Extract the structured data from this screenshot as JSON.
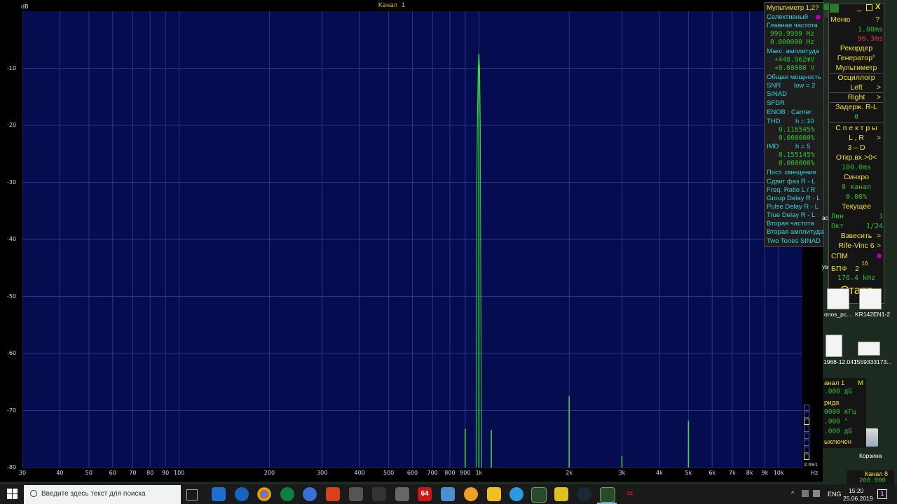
{
  "spectrum": {
    "channel_title": "Канал 1",
    "y_unit": "dB",
    "y_ticks": [
      "-10",
      "-20",
      "-30",
      "-40",
      "-50",
      "-60",
      "-70",
      "-80"
    ],
    "x_ticks": [
      "30",
      "40",
      "50",
      "60",
      "70",
      "80",
      "90",
      "100",
      "200",
      "300",
      "400",
      "500",
      "600",
      "700",
      "800",
      "900",
      "1k",
      "2k",
      "3k",
      "4k",
      "5k",
      "6k",
      "7k",
      "8k",
      "9k",
      "10k"
    ],
    "x_unit": "Hz",
    "corner_value": "2.691",
    "peaks_hz": [
      900,
      1000,
      1100,
      2000,
      3000,
      5000
    ],
    "peaks_db": [
      -73.2,
      -7.5,
      -73.4,
      -67.5,
      -78.0,
      -71.8
    ],
    "colors": {
      "trace": "#3adf3a",
      "plot_bg": "#050d50",
      "grid": "#2a3590"
    }
  },
  "multimeter": {
    "title": "Мультиметр 1,2?",
    "selective": "Селективный",
    "main_freq_label": "Главная частота",
    "main_freq_value": "999.9999  Hz",
    "main_freq_value2": "0.000000  Hz",
    "max_amp_label": "Макс. амплитуда",
    "max_amp_value": "+448.962mV",
    "max_amp_value2": "+0.00000  V",
    "total_power": "Общая мощность",
    "snr": "SNR",
    "snr_low": "low =  2",
    "sinad": "SINAD",
    "sfdr": "SFDR",
    "enob": "ENOB : Carrier",
    "thd": "THD",
    "thd_h": "h = 10",
    "thd_v1": "0.116545%",
    "thd_v2": "0.000000%",
    "imd": "IMD",
    "imd_h": "h =  5",
    "imd_v1": "0.155145%",
    "imd_v2": "0.000000%",
    "dc_offset": "Пост. смещение",
    "phase_shift": "Сдвиг фаз R - L",
    "freq_ratio": "Freq. Ratio  L / R",
    "group_delay": "Group Delay R - L",
    "pulse_delay": "Pulse Delay R - L",
    "true_delay": "True Delay R - L",
    "second_freq": "Вторая частота",
    "second_amp": "Вторая амплитуда",
    "two_tones": "Two Tones SINAD"
  },
  "control": {
    "menu": "Меню",
    "help": "?",
    "time1": "1.00ms",
    "time2": "96.3ms",
    "recorder": "Рекордер",
    "generator": "Генератор°",
    "multimeter": "Мультиметр",
    "oscilloscope": "Осциллогр",
    "left": "Left",
    "right": "Right",
    "delay": "Задерж. R-L",
    "delay_val": "0",
    "spectra": "С п е к т р ы",
    "lr": "L , R",
    "threed": "3 – D",
    "open_input": "Откр.вх.>0<",
    "open_input_val": "100.0ms",
    "sync": "Синхро",
    "sync_val": "0 канал",
    "sync_val2": "0.00%",
    "current": "Текущее",
    "lin": "Лин",
    "lin_val": "1",
    "okt": "Окт",
    "okt_val": "1/24",
    "weigh": "Взвесить",
    "window": "Rife-Vinc 6",
    "spm": "СПМ",
    "fft": "БПФ",
    "fft_val": "2",
    "fft_pow": "16",
    "fft_rate": "176.4 kHz",
    "start": "Старт",
    "arrow": ">"
  },
  "desktop": {
    "icon1": "onos_pc...",
    "icon2": "KR142EN1-2",
    "icon3": "1968-12.047",
    "icon4": "1559333173...",
    "trash": "Корзина",
    "left_cut1": "ac",
    "left_cut2": "ya"
  },
  "generator": {
    "title": "анал 1",
    "m": "M",
    "v1": ".000 дБ",
    "form": "рида",
    "v2": "0000 кГц",
    "v3": ".000 °",
    "v4": ".000 дБ",
    "off": "ыключен",
    "canal8": "Канал 8",
    "canal8_val": "200.000"
  },
  "taskbar": {
    "search_placeholder": "Введите здесь текст для поиска",
    "lang": "ENG",
    "time": "15:20",
    "date": "25.06.2019",
    "notify_count": "1",
    "badge64": "64"
  }
}
